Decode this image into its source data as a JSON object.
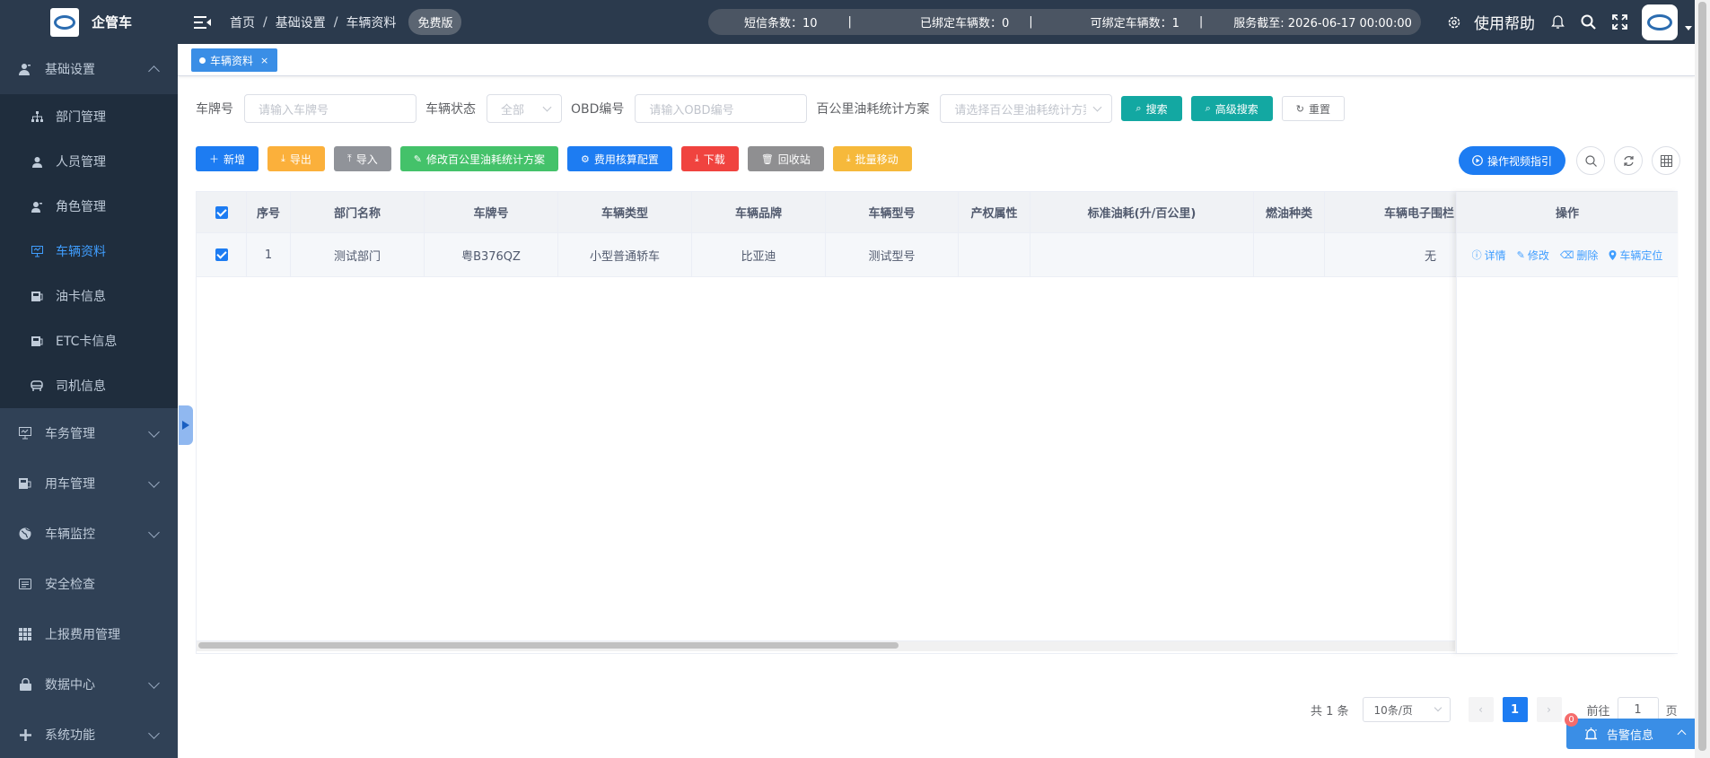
{
  "app": {
    "title": "企管车"
  },
  "topbar": {
    "breadcrumb": [
      "首页",
      "基础设置",
      "车辆资料"
    ],
    "breadcrumb_sep": "/",
    "badge": "免费版",
    "stats": {
      "sms": "短信条数：10",
      "bound": "已绑定车辆数：0",
      "bindable": "可绑定车辆数：1",
      "expire": "服务截至: 2026-06-17 00:00:00",
      "sep": "|"
    },
    "help": "使用帮助",
    "icons": [
      "gear-icon",
      "bell-icon",
      "search-icon",
      "fullscreen-icon"
    ]
  },
  "sidebar": {
    "groups": [
      {
        "label": "基础设置",
        "icon": "user-icon",
        "open": true,
        "items": [
          {
            "label": "部门管理",
            "icon": "org-tree-icon"
          },
          {
            "label": "人员管理",
            "icon": "person-icon"
          },
          {
            "label": "角色管理",
            "icon": "role-icon"
          },
          {
            "label": "车辆资料",
            "icon": "monitor-icon",
            "active": true
          },
          {
            "label": "油卡信息",
            "icon": "card-icon"
          },
          {
            "label": "ETC卡信息",
            "icon": "card-icon"
          },
          {
            "label": "司机信息",
            "icon": "driver-icon"
          }
        ]
      },
      {
        "label": "车务管理",
        "icon": "monitor-icon"
      },
      {
        "label": "用车管理",
        "icon": "car-icon"
      },
      {
        "label": "车辆监控",
        "icon": "globe-icon"
      },
      {
        "label": "安全检查",
        "icon": "checklist-icon"
      },
      {
        "label": "上报费用管理",
        "icon": "grid-icon"
      },
      {
        "label": "数据中心",
        "icon": "lock-icon"
      },
      {
        "label": "系统功能",
        "icon": "plus-icon"
      }
    ]
  },
  "tags": [
    {
      "label": "车辆资料",
      "close": "×"
    }
  ],
  "search": {
    "plate_label": "车牌号",
    "plate_placeholder": "请输入车牌号",
    "status_label": "车辆状态",
    "status_value": "全部",
    "obd_label": "OBD编号",
    "obd_placeholder": "请输入OBD编号",
    "fuel_label": "百公里油耗统计方案",
    "fuel_placeholder": "请选择百公里油耗统计方案",
    "search_btn": "搜索",
    "advanced_btn": "高级搜索",
    "reset_btn": "重置"
  },
  "actions": {
    "add": "新增",
    "export": "导出",
    "import": "导入",
    "modify_fuel": "修改百公里油耗统计方案",
    "cost_config": "费用核算配置",
    "download": "下载",
    "recycle": "回收站",
    "batch_move": "批量移动",
    "video_guide": "操作视频指引"
  },
  "table": {
    "columns": [
      "序号",
      "部门名称",
      "车牌号",
      "车辆类型",
      "车辆品牌",
      "车辆型号",
      "产权属性",
      "标准油耗(升/百公里)",
      "燃油种类",
      "车辆电子围栏",
      "操作"
    ],
    "rows": [
      {
        "index": "1",
        "dept": "测试部门",
        "plate": "粤B376QZ",
        "type": "小型普通轿车",
        "brand": "比亚迪",
        "model": "测试型号",
        "property": "",
        "fuel_std": "",
        "fuel_kind": "",
        "fence": "无"
      }
    ],
    "row_actions": [
      "详情",
      "修改",
      "删除",
      "车辆定位"
    ]
  },
  "pagination": {
    "total": "共 1 条",
    "page_size": "10条/页",
    "current": "1",
    "prev": "‹",
    "next": "›",
    "goto_label": "前往",
    "goto_value": "1",
    "goto_unit": "页"
  },
  "alarm": {
    "label": "告警信息",
    "count": "0"
  },
  "colors": {
    "sidebar": "#304156",
    "topbar": "#2b3a4d",
    "primary": "#1d7cf2",
    "teal": "#13a8a2",
    "active": "#409eff"
  }
}
